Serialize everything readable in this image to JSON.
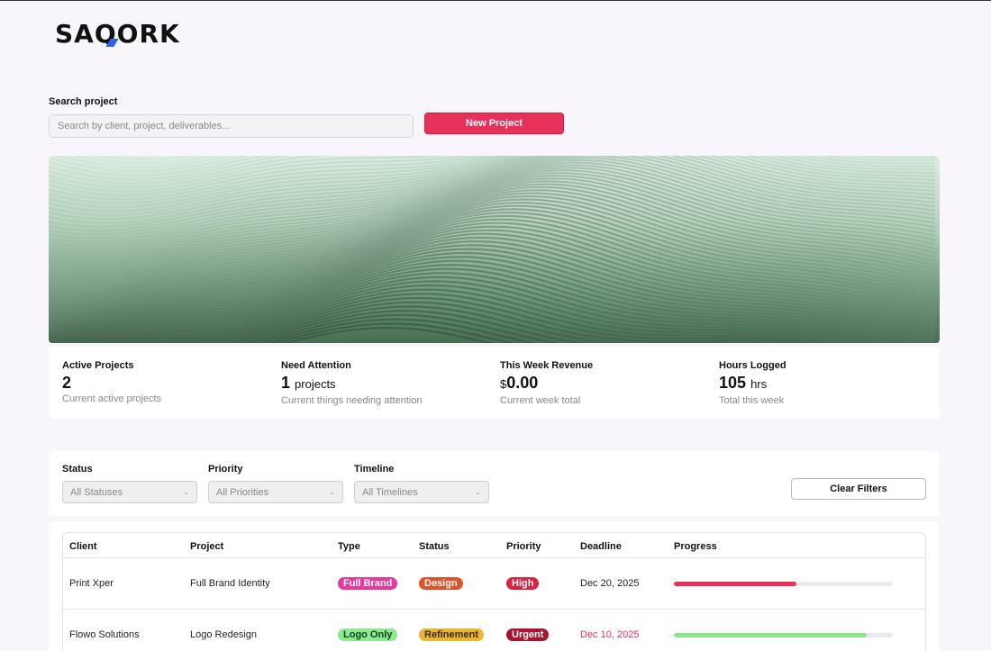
{
  "brand": {
    "name_pre": "SA",
    "name_q": "Q",
    "name_post": "ORK",
    "accent": "#2f63e8"
  },
  "search": {
    "label": "Search project",
    "placeholder": "Search by client, project, deliverables..."
  },
  "actions": {
    "new_project": "New Project",
    "primary_color": "#e8315a"
  },
  "stats": [
    {
      "label": "Active Projects",
      "value": "2",
      "unit": "",
      "sub": "Current active projects"
    },
    {
      "label": "Need Attention",
      "value": "1",
      "unit": "projects",
      "sub": "Current things needing attention"
    },
    {
      "label": "This Week Revenue",
      "currency": "$",
      "value": "0.00",
      "sub": "Current week total"
    },
    {
      "label": "Hours Logged",
      "value": "105",
      "unit": "hrs",
      "sub": "Total this week"
    }
  ],
  "filters": {
    "status": {
      "label": "Status",
      "value": "All Statuses"
    },
    "priority": {
      "label": "Priority",
      "value": "All Priorities"
    },
    "timeline": {
      "label": "Timeline",
      "value": "All Timelines"
    },
    "clear": "Clear Filters"
  },
  "table": {
    "columns": [
      "Client",
      "Project",
      "Type",
      "Status",
      "Priority",
      "Deadline",
      "Progress"
    ],
    "rows": [
      {
        "client": "Print Xper",
        "project": "Full Brand Identity",
        "type": "Full Brand",
        "type_bg": "#e6399b",
        "type_fg": "#ffffff",
        "status": "Design",
        "status_bg": "#e0522a",
        "status_fg": "#ffffff",
        "priority": "High",
        "priority_bg": "#d8243f",
        "priority_fg": "#ffffff",
        "deadline": "Dec 20, 2025",
        "deadline_color": "#222222",
        "progress": 0.56,
        "progress_color": "#e8315a"
      },
      {
        "client": "Flowo Solutions",
        "project": "Logo Redesign",
        "type": "Logo Only",
        "type_bg": "#8be98f",
        "type_fg": "#14421a",
        "status": "Refinement",
        "status_bg": "#e9b632",
        "status_fg": "#3a2a00",
        "priority": "Urgent",
        "priority_bg": "#a9132c",
        "priority_fg": "#ffffff",
        "deadline": "Dec 10, 2025",
        "deadline_color": "#e8315a",
        "progress": 0.88,
        "progress_color": "#86e88a"
      }
    ]
  }
}
